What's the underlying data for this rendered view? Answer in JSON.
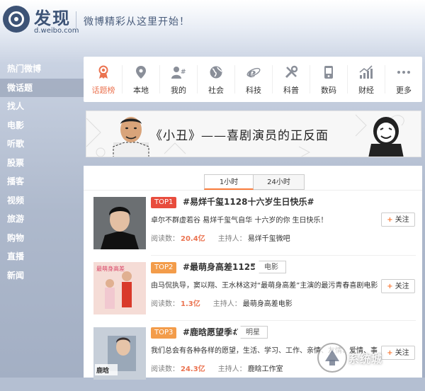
{
  "header": {
    "title": "发现",
    "domain": "d.weibo.com",
    "slogan": "微博精彩从这里开始！"
  },
  "sidebar": {
    "items": [
      {
        "label": "热门微博"
      },
      {
        "label": "微话题"
      },
      {
        "label": "找人"
      },
      {
        "label": "电影"
      },
      {
        "label": "听歌"
      },
      {
        "label": "股票"
      },
      {
        "label": "播客"
      },
      {
        "label": "视频"
      },
      {
        "label": "旅游"
      },
      {
        "label": "购物"
      },
      {
        "label": "直播"
      },
      {
        "label": "新闻"
      }
    ],
    "active_index": 1
  },
  "categories": [
    {
      "label": "话题榜",
      "icon": "medal-icon"
    },
    {
      "label": "本地",
      "icon": "location-pin-icon"
    },
    {
      "label": "我的",
      "icon": "user-hash-icon"
    },
    {
      "label": "社会",
      "icon": "globe-icon"
    },
    {
      "label": "科技",
      "icon": "ie-browser-icon"
    },
    {
      "label": "科普",
      "icon": "tools-icon"
    },
    {
      "label": "数码",
      "icon": "phone-icon"
    },
    {
      "label": "财经",
      "icon": "bar-chart-icon"
    },
    {
      "label": "更多",
      "icon": "more-dots-icon"
    }
  ],
  "banner": {
    "text": "《小丑》——喜剧演员的正反面"
  },
  "toggle": {
    "tab1": "1小时",
    "tab2": "24小时"
  },
  "topics": [
    {
      "rank": "TOP1",
      "title": "#易烊千玺1128十六岁生日快乐#",
      "tag": "",
      "desc": "卓尔不群虚若谷 易烊千玺气自华 十六岁的你 生日快乐！",
      "read_label": "阅读数：",
      "read_count": "20.4亿",
      "host_label": "主持人：",
      "host": "易烊千玺微吧",
      "follow": "关注"
    },
    {
      "rank": "TOP2",
      "title": "#最萌身高差1125#",
      "tag": "电影",
      "desc": "由马侃执导，窦以翔、王水林这对“最萌身高差”主演的最污青春喜剧电影…",
      "read_label": "阅读数：",
      "read_count": "1.3亿",
      "host_label": "主持人：",
      "host": "最萌身高差电影",
      "follow": "关注"
    },
    {
      "rank": "TOP3",
      "title": "#鹿晗愿望季#",
      "tag": "明星",
      "desc": "我们总会有各种各样的愿望，生活、学习、工作、亲情、友情、爱情、事…",
      "read_label": "阅读数：",
      "read_count": "24.3亿",
      "host_label": "主持人：",
      "host": "鹿晗工作室",
      "follow": "关注"
    }
  ],
  "watermark": "系统城",
  "colors": {
    "accent": "#eb7350",
    "rank1": "#e84c3d",
    "rank2": "#f39c4a",
    "rank3": "#f39c4a",
    "brand_blue": "#3d5376"
  }
}
